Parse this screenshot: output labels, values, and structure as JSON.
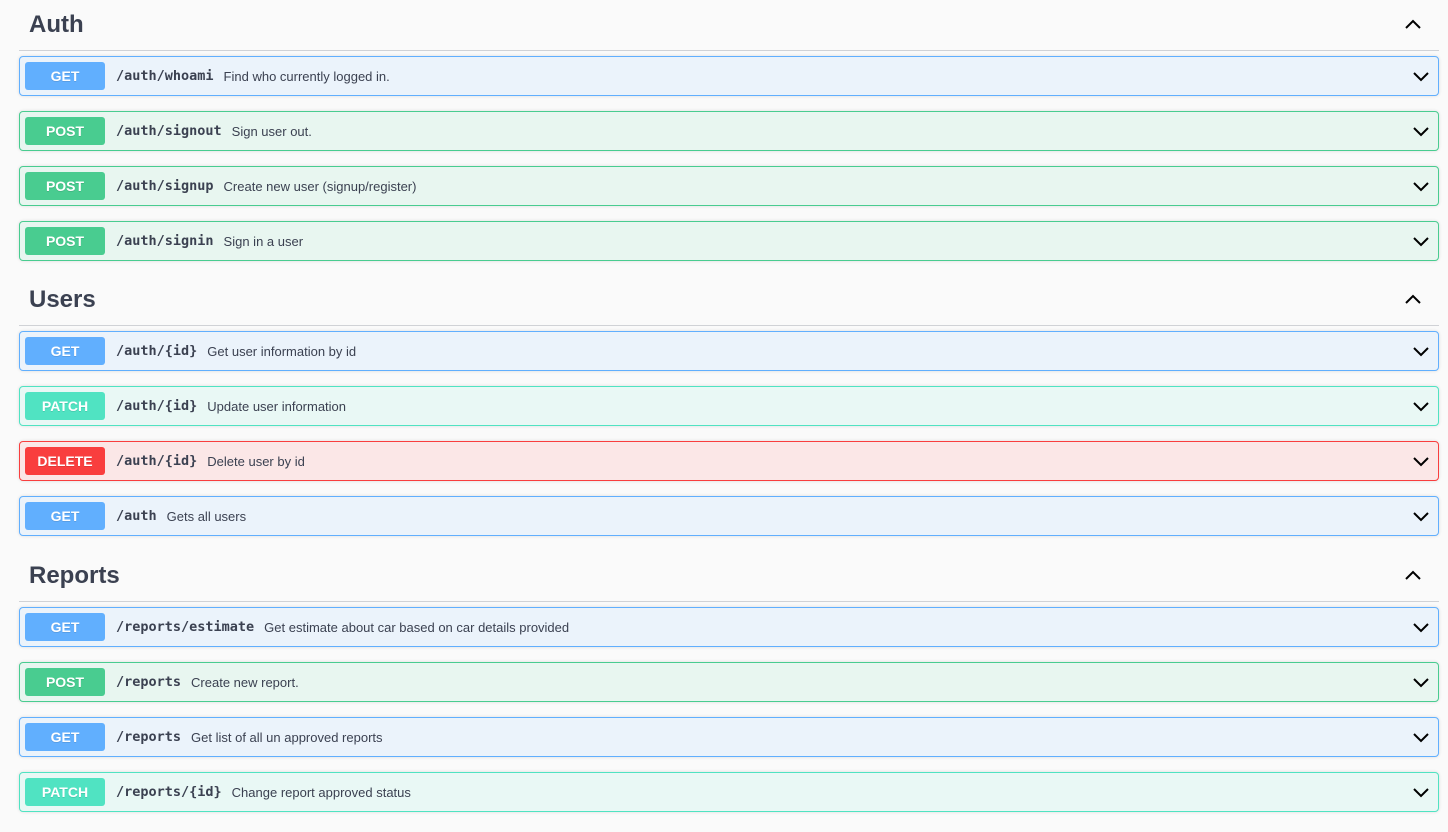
{
  "sections": [
    {
      "title": "Auth",
      "operations": [
        {
          "method": "GET",
          "path": "/auth/whoami",
          "summary": "Find who currently logged in."
        },
        {
          "method": "POST",
          "path": "/auth/signout",
          "summary": "Sign user out."
        },
        {
          "method": "POST",
          "path": "/auth/signup",
          "summary": "Create new user (signup/register)"
        },
        {
          "method": "POST",
          "path": "/auth/signin",
          "summary": "Sign in a user"
        }
      ]
    },
    {
      "title": "Users",
      "operations": [
        {
          "method": "GET",
          "path": "/auth/{id}",
          "summary": "Get user information by id"
        },
        {
          "method": "PATCH",
          "path": "/auth/{id}",
          "summary": "Update user information"
        },
        {
          "method": "DELETE",
          "path": "/auth/{id}",
          "summary": "Delete user by id"
        },
        {
          "method": "GET",
          "path": "/auth",
          "summary": "Gets all users"
        }
      ]
    },
    {
      "title": "Reports",
      "operations": [
        {
          "method": "GET",
          "path": "/reports/estimate",
          "summary": "Get estimate about car based on car details provided"
        },
        {
          "method": "POST",
          "path": "/reports",
          "summary": "Create new report."
        },
        {
          "method": "GET",
          "path": "/reports",
          "summary": "Get list of all un approved reports"
        },
        {
          "method": "PATCH",
          "path": "/reports/{id}",
          "summary": "Change report approved status"
        }
      ]
    }
  ],
  "colors": {
    "get": "#61affe",
    "post": "#49cc90",
    "patch": "#50e3c2",
    "delete": "#f93e3e"
  },
  "icons": {
    "section_toggle": "chevron-up-icon",
    "operation_toggle": "chevron-down-icon"
  }
}
